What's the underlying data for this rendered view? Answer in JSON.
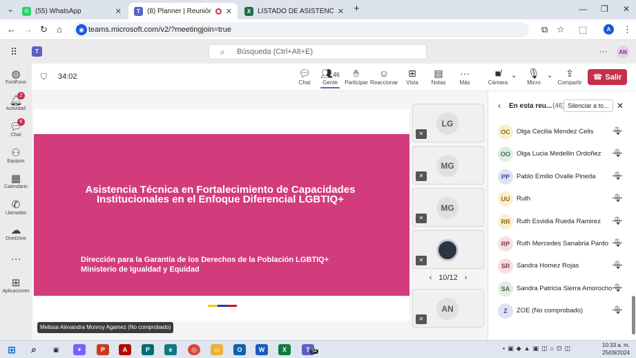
{
  "browser": {
    "tabs": [
      {
        "title": "(55) WhatsApp",
        "icon": "whatsapp-icon",
        "color": "#25d366"
      },
      {
        "title": "(8) Planner | Reunión de M...",
        "icon": "teams-icon",
        "color": "#5b5fc7",
        "active": true
      },
      {
        "title": "LISTADO DE ASISTENCIA - ASIS...",
        "icon": "excel-icon",
        "color": "#1d7044"
      }
    ],
    "url": "teams.microsoft.com/v2/?meetingjoin=true"
  },
  "teams": {
    "search_placeholder": "Búsqueda (Ctrl+Alt+E)",
    "user_initials": "AN",
    "profile_initial": "A"
  },
  "rail": [
    {
      "label": "FortiFone",
      "icon": "phone-app-icon"
    },
    {
      "label": "Actividad",
      "icon": "bell-icon",
      "badge": "2"
    },
    {
      "label": "Chat",
      "icon": "chat-icon",
      "badge": "6"
    },
    {
      "label": "Equipos",
      "icon": "teams-group-icon"
    },
    {
      "label": "Calendario",
      "icon": "calendar-icon"
    },
    {
      "label": "Llamadas",
      "icon": "call-icon"
    },
    {
      "label": "OneDrive",
      "icon": "cloud-icon"
    },
    {
      "label": "",
      "icon": "more-icon"
    },
    {
      "label": "Aplicaciones",
      "icon": "apps-icon"
    }
  ],
  "meeting": {
    "timer": "34:02",
    "people_count": "46",
    "toolbar": [
      {
        "label": "Chat",
        "icon": "chat-icon"
      },
      {
        "label": "Gente",
        "icon": "people-icon"
      },
      {
        "label": "Participar",
        "icon": "raise-hand-icon"
      },
      {
        "label": "Reaccionar",
        "icon": "emoji-icon"
      },
      {
        "label": "Vista",
        "icon": "grid-view-icon"
      },
      {
        "label": "Notas",
        "icon": "notes-icon"
      },
      {
        "label": "Más",
        "icon": "more-icon"
      },
      {
        "label": "Cámara",
        "icon": "camera-off-icon"
      },
      {
        "label": "Micro",
        "icon": "mic-off-icon"
      },
      {
        "label": "Compartir",
        "icon": "share-icon"
      }
    ],
    "leave_label": "Salir"
  },
  "slide": {
    "title": "Asistencia Técnica en Fortalecimiento de Capacidades Institucionales en el Enfoque Diferencial LGBTIQ+",
    "subtitle_line1": "Dirección para la Garantía de los Derechos de la Población LGBTIQ+",
    "subtitle_line2": "Ministerio de Igualdad y Equidad",
    "accent": "#d23c7c",
    "speaker": "Melissa Alexandra Monroy Agamez (No comprobado)"
  },
  "tiles": [
    {
      "initials": "LG"
    },
    {
      "initials": "MG"
    },
    {
      "initials": "MG"
    },
    {
      "initials": ""
    },
    {
      "initials": "AN"
    }
  ],
  "pager": "10/12",
  "panel": {
    "title": "En esta reu...",
    "count": "(46)",
    "mute_all": "Silenciar a to...",
    "participants": [
      {
        "initials": "OC",
        "name": "Olga Cecilia Mendez Celis",
        "color": "#fbeed0",
        "text": "#8a6a16"
      },
      {
        "initials": "OO",
        "name": "Olga Lucia Medellin Ordoñez",
        "color": "#e0ece1",
        "text": "#3f6e43"
      },
      {
        "initials": "PP",
        "name": "Pablo Emilio Ovalle Pineda",
        "color": "#dde3f5",
        "text": "#3b4d8a"
      },
      {
        "initials": "UU",
        "name": "Ruth",
        "color": "#fbeed0",
        "text": "#8a6a16"
      },
      {
        "initials": "RR",
        "name": "Ruth Esvidia Rueda Ramirez",
        "color": "#fbeed0",
        "text": "#8a6a16"
      },
      {
        "initials": "RP",
        "name": "Ruth Mercedes Sanabria Pardo",
        "color": "#f6dfe3",
        "text": "#8a3a4a"
      },
      {
        "initials": "SR",
        "name": "Sandra Homez Rojas",
        "color": "#f6dfe3",
        "text": "#8a3a4a"
      },
      {
        "initials": "SA",
        "name": "Sandra Patricia Sierra Amorocho",
        "color": "#e0ece1",
        "text": "#3f6e43"
      },
      {
        "initials": "Z",
        "name": "ZOE (No comprobado)",
        "color": "#dde3f5",
        "text": "#3b4d8a"
      }
    ]
  },
  "taskbar": {
    "time": "10:33 a. m.",
    "date": "25/09/2024",
    "teams_badge": "54"
  }
}
